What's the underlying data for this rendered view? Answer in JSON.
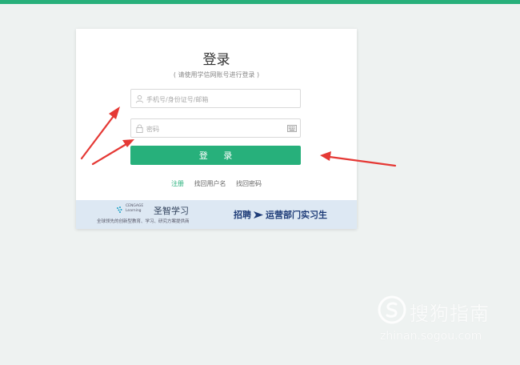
{
  "login": {
    "title": "登录",
    "subtitle": "( 请使用学信网账号进行登录 )",
    "username_placeholder": "手机号/身份证号/邮箱",
    "password_placeholder": "密码",
    "submit_label": "登 录",
    "links": {
      "register": "注册",
      "find_username": "找回用户名",
      "find_password": "找回密码"
    }
  },
  "banner": {
    "brand_en_line1": "CENGAGE",
    "brand_en_line2": "Learning",
    "brand_cn": "圣智学习",
    "slogan": "全球领先的创新型教育、学习、研究方案提供商",
    "recruit_left": "招聘",
    "recruit_right": "运营部门实习生"
  },
  "watermark": {
    "text": "搜狗指南",
    "url": "zhinan.sogou.com"
  },
  "colors": {
    "accent": "#27b07b",
    "annotation_arrow": "#e53935",
    "banner_bg": "#dde8f3"
  }
}
